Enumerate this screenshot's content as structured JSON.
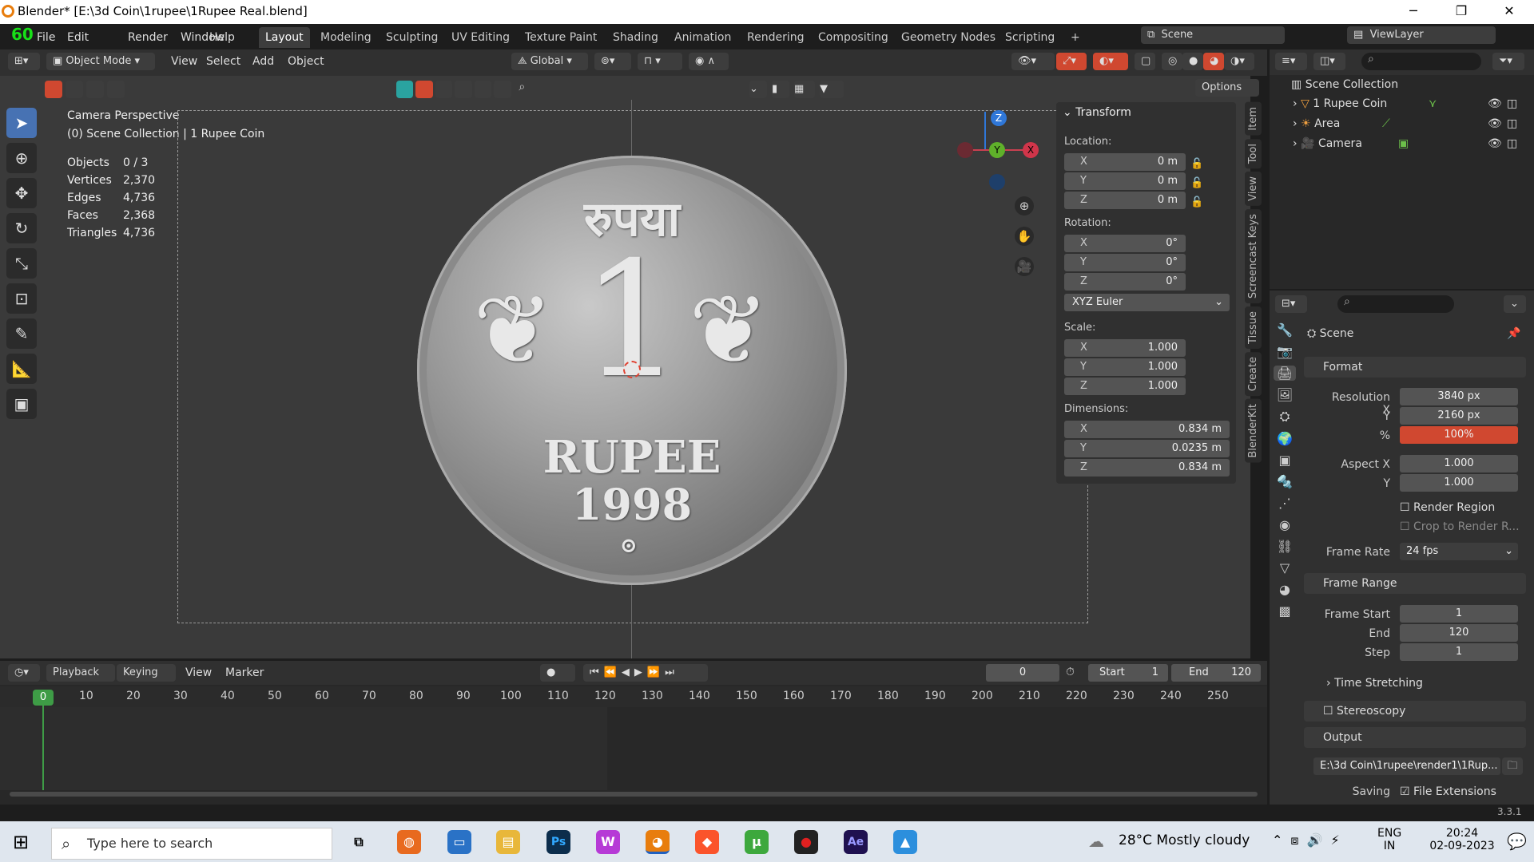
{
  "titlebar": {
    "title": "Blender* [E:\\3d Coin\\1rupee\\1Rupee Real.blend]"
  },
  "fps_overlay": "60",
  "menu": [
    "File",
    "Edit",
    "Render",
    "Window",
    "Help"
  ],
  "workspaces": [
    "Layout",
    "Modeling",
    "Sculpting",
    "UV Editing",
    "Texture Paint",
    "Shading",
    "Animation",
    "Rendering",
    "Compositing",
    "Geometry Nodes",
    "Scripting"
  ],
  "active_workspace": "Layout",
  "scene": {
    "label": "Scene",
    "view_layer": "ViewLayer"
  },
  "viewport_header": {
    "mode": "Object Mode",
    "menus": [
      "View",
      "Select",
      "Add",
      "Object"
    ],
    "transform_orientation": "Global",
    "options": "Options"
  },
  "viewport_info": {
    "camera": "Camera Perspective",
    "collection": "(0) Scene Collection | 1 Rupee Coin",
    "stats": [
      {
        "label": "Objects",
        "value": "0 / 3"
      },
      {
        "label": "Vertices",
        "value": "2,370"
      },
      {
        "label": "Edges",
        "value": "4,736"
      },
      {
        "label": "Faces",
        "value": "2,368"
      },
      {
        "label": "Triangles",
        "value": "4,736"
      }
    ]
  },
  "coin": {
    "top_text": "रुपया",
    "numeral": "1",
    "word": "RUPEE",
    "year": "1998"
  },
  "gizmo": {
    "z": "Z",
    "y": "Y",
    "x": "X"
  },
  "transform": {
    "title": "Transform",
    "location_label": "Location:",
    "location": [
      {
        "axis": "X",
        "value": "0 m"
      },
      {
        "axis": "Y",
        "value": "0 m"
      },
      {
        "axis": "Z",
        "value": "0 m"
      }
    ],
    "rotation_label": "Rotation:",
    "rotation": [
      {
        "axis": "X",
        "value": "0°"
      },
      {
        "axis": "Y",
        "value": "0°"
      },
      {
        "axis": "Z",
        "value": "0°"
      }
    ],
    "rotation_mode": "XYZ Euler",
    "scale_label": "Scale:",
    "scale": [
      {
        "axis": "X",
        "value": "1.000"
      },
      {
        "axis": "Y",
        "value": "1.000"
      },
      {
        "axis": "Z",
        "value": "1.000"
      }
    ],
    "dimensions_label": "Dimensions:",
    "dimensions": [
      {
        "axis": "X",
        "value": "0.834 m"
      },
      {
        "axis": "Y",
        "value": "0.0235 m"
      },
      {
        "axis": "Z",
        "value": "0.834 m"
      }
    ]
  },
  "side_tabs": [
    "Item",
    "Tool",
    "View",
    "Screencast Keys",
    "Tissue",
    "Create",
    "BlenderKit"
  ],
  "timeline": {
    "menus": [
      "Playback",
      "Keying",
      "View",
      "Marker"
    ],
    "current_frame": "0",
    "start_label": "Start",
    "start": "1",
    "end_label": "End",
    "end": "120",
    "ticks": [
      "0",
      "10",
      "20",
      "30",
      "40",
      "50",
      "60",
      "70",
      "80",
      "90",
      "100",
      "110",
      "120",
      "130",
      "140",
      "150",
      "160",
      "170",
      "180",
      "190",
      "200",
      "210",
      "220",
      "230",
      "240",
      "250"
    ]
  },
  "outliner": {
    "root": "Scene Collection",
    "items": [
      "1 Rupee Coin",
      "Area",
      "Camera"
    ]
  },
  "properties": {
    "scene_label": "Scene",
    "format": {
      "title": "Format",
      "res_x_label": "Resolution X",
      "res_x": "3840 px",
      "res_y_label": "Y",
      "res_y": "2160 px",
      "pct_label": "%",
      "pct": "100%",
      "aspect_x_label": "Aspect X",
      "aspect_x": "1.000",
      "aspect_y_label": "Y",
      "aspect_y": "1.000",
      "render_region": "Render Region",
      "crop": "Crop to Render R...",
      "frame_rate_label": "Frame Rate",
      "frame_rate": "24 fps"
    },
    "frame_range": {
      "title": "Frame Range",
      "start_label": "Frame Start",
      "start": "1",
      "end_label": "End",
      "end": "120",
      "step_label": "Step",
      "step": "1"
    },
    "time_stretching": "Time Stretching",
    "stereoscopy": "Stereoscopy",
    "output": {
      "title": "Output",
      "path": "E:\\3d Coin\\1rupee\\render1\\1Rup...",
      "saving_label": "Saving",
      "file_ext": "File Extensions"
    }
  },
  "status_version": "3.3.1",
  "taskbar": {
    "search": "Type here to search",
    "weather": "28°C  Mostly cloudy",
    "lang1": "ENG",
    "lang2": "IN",
    "time": "20:24",
    "date": "02-09-2023"
  }
}
